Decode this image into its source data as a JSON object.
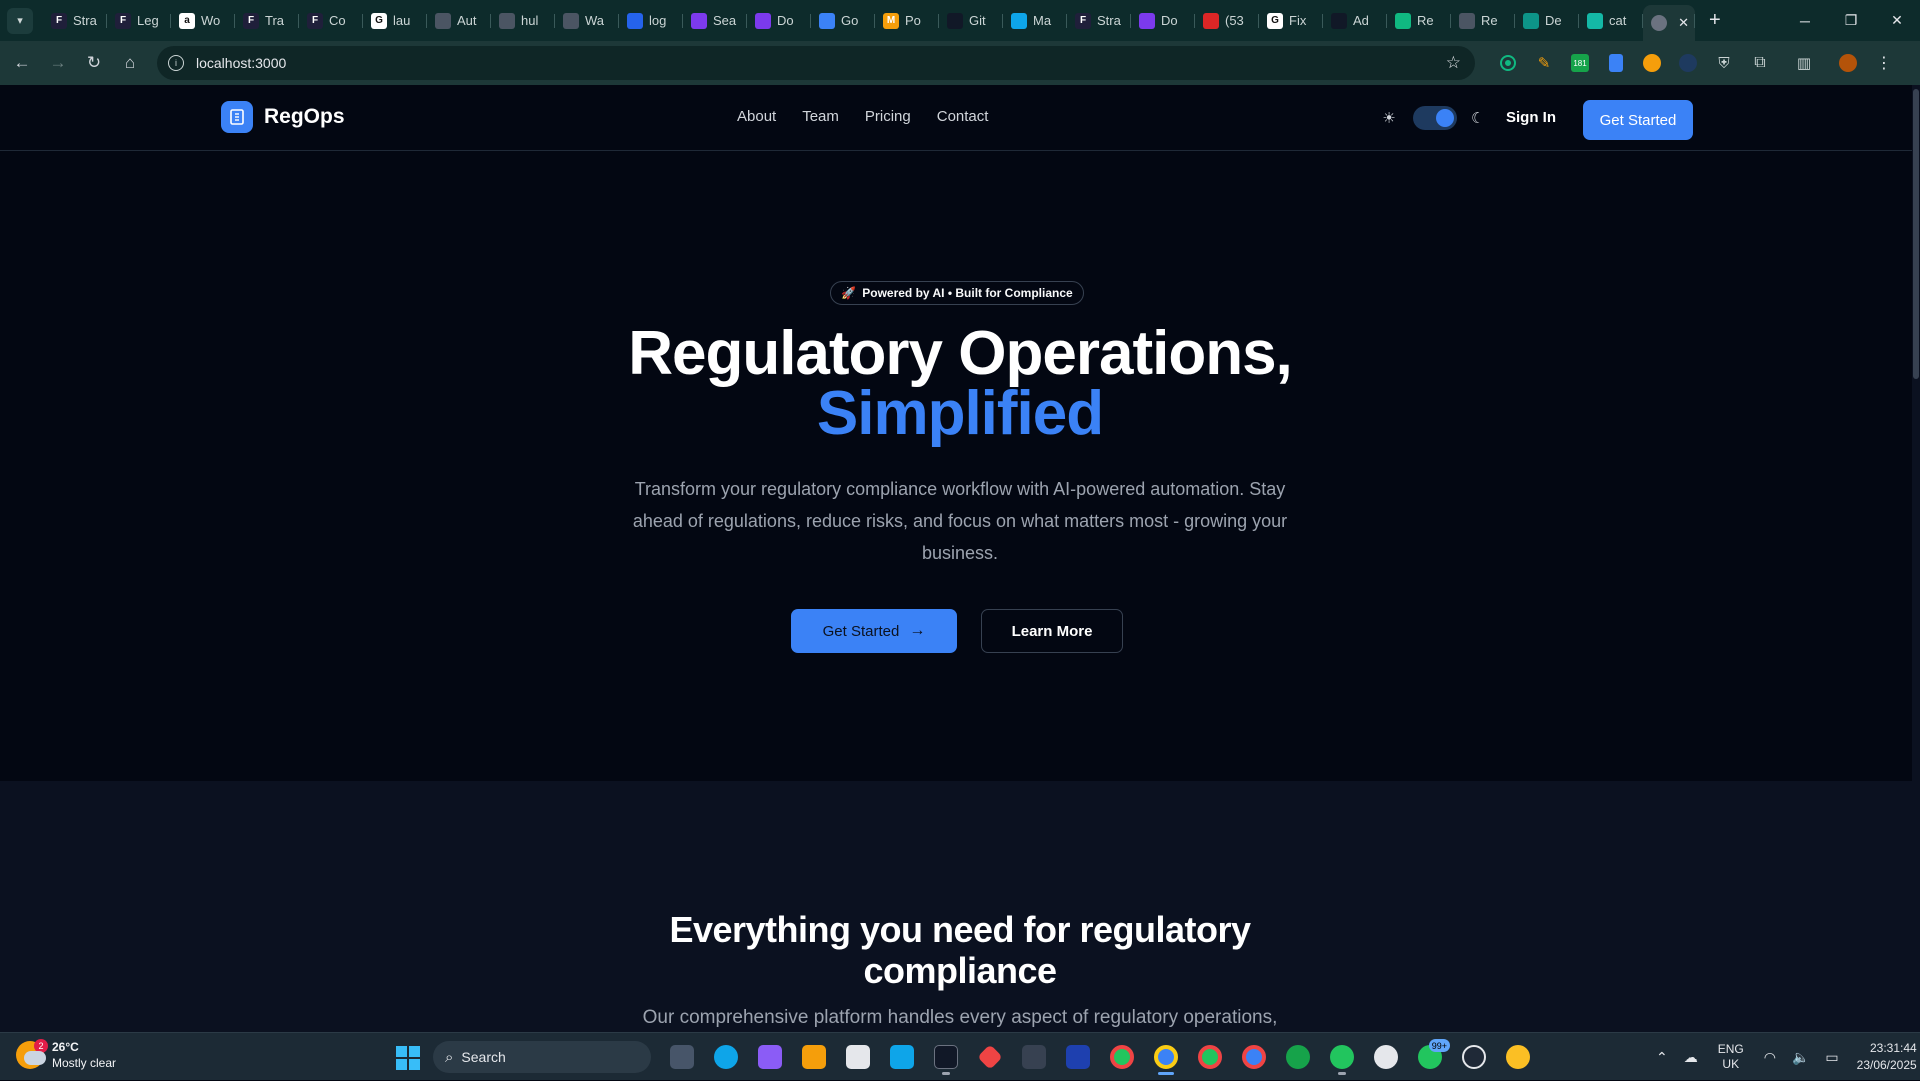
{
  "browser": {
    "tabs": [
      {
        "label": "Stra",
        "fav_color": "#1f1f3a",
        "fav_text": "F"
      },
      {
        "label": "Leg",
        "fav_color": "#1f1f3a",
        "fav_text": "F"
      },
      {
        "label": "Wo",
        "fav_color": "#ffffff",
        "fav_text": "a"
      },
      {
        "label": "Tra",
        "fav_color": "#1f1f3a",
        "fav_text": "F"
      },
      {
        "label": "Co",
        "fav_color": "#1f1f3a",
        "fav_text": "F"
      },
      {
        "label": "lau",
        "fav_color": "#ffffff",
        "fav_text": "G"
      },
      {
        "label": "Aut",
        "fav_color": "#4b5563",
        "fav_text": ""
      },
      {
        "label": "hul",
        "fav_color": "#4b5563",
        "fav_text": ""
      },
      {
        "label": "Wa",
        "fav_color": "#4b5563",
        "fav_text": ""
      },
      {
        "label": "log",
        "fav_color": "#2563eb",
        "fav_text": ""
      },
      {
        "label": "Sea",
        "fav_color": "#7c3aed",
        "fav_text": ""
      },
      {
        "label": "Do",
        "fav_color": "#7c3aed",
        "fav_text": ""
      },
      {
        "label": "Go",
        "fav_color": "#3b82f6",
        "fav_text": ""
      },
      {
        "label": "Po",
        "fav_color": "#f59e0b",
        "fav_text": "M"
      },
      {
        "label": "Git",
        "fav_color": "#111827",
        "fav_text": ""
      },
      {
        "label": "Ma",
        "fav_color": "#0ea5e9",
        "fav_text": ""
      },
      {
        "label": "Stra",
        "fav_color": "#1f1f3a",
        "fav_text": "F"
      },
      {
        "label": "Do",
        "fav_color": "#7c3aed",
        "fav_text": ""
      },
      {
        "label": "(53",
        "fav_color": "#dc2626",
        "fav_text": ""
      },
      {
        "label": "Fix",
        "fav_color": "#ffffff",
        "fav_text": "G"
      },
      {
        "label": "Ad",
        "fav_color": "#111827",
        "fav_text": ""
      },
      {
        "label": "Re",
        "fav_color": "#10b981",
        "fav_text": ""
      },
      {
        "label": "Re",
        "fav_color": "#4b5563",
        "fav_text": ""
      },
      {
        "label": "De",
        "fav_color": "#0d9488",
        "fav_text": ""
      },
      {
        "label": "cat",
        "fav_color": "#14b8a6",
        "fav_text": ""
      }
    ],
    "url": "localhost:3000",
    "new_tab_glyph": "+",
    "close_glyph": "✕"
  },
  "site": {
    "brand": "RegOps",
    "nav": [
      "About",
      "Team",
      "Pricing",
      "Contact"
    ],
    "sign_in": "Sign In",
    "header_cta": "Get Started",
    "theme_mode": "dark"
  },
  "hero": {
    "badge": "Powered by AI • Built for Compliance",
    "title_line1": "Regulatory Operations,",
    "title_line2": "Simplified",
    "subtitle": "Transform your regulatory compliance workflow with AI-powered automation. Stay ahead of regulations, reduce risks, and focus on what matters most - growing your business.",
    "primary_cta": "Get Started",
    "secondary_cta": "Learn More"
  },
  "features": {
    "title": "Everything you need for regulatory compliance",
    "subtitle": "Our comprehensive platform handles every aspect of regulatory operations,"
  },
  "taskbar": {
    "weather_temp": "26°C",
    "weather_desc": "Mostly clear",
    "weather_badge": "2",
    "search_label": "Search",
    "whatsapp_badge": "99+",
    "lang_line1": "ENG",
    "lang_line2": "UK",
    "time": "23:31:44",
    "date": "23/06/2025",
    "extension_badge": "181"
  },
  "colors": {
    "accent": "#3b82f6",
    "page_bg": "#030712",
    "section_bg": "#0b1120",
    "muted_text": "#9ca3af"
  }
}
